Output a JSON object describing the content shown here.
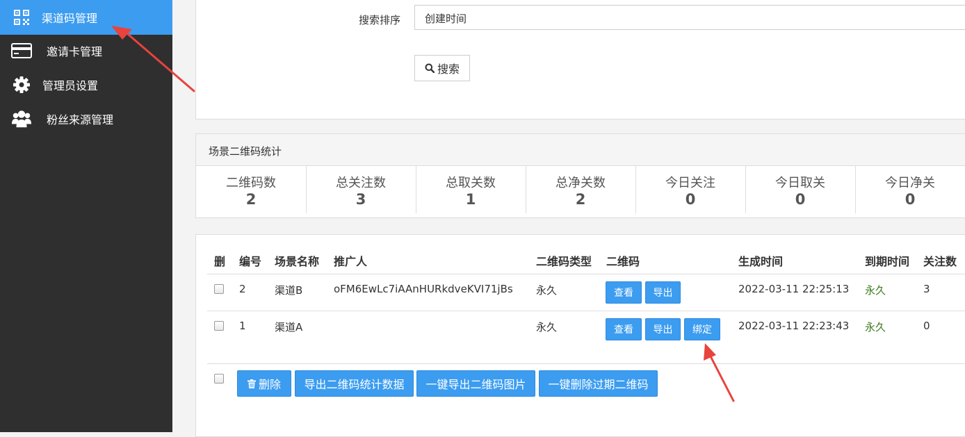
{
  "sidebar": {
    "items": [
      {
        "label": "渠道码管理",
        "icon": "qrcode-icon"
      },
      {
        "label": "邀请卡管理",
        "icon": "credit-card-icon"
      },
      {
        "label": "管理员设置",
        "icon": "gear-icon"
      },
      {
        "label": "粉丝来源管理",
        "icon": "users-icon"
      }
    ],
    "active_color": "#3c9cf0",
    "bg_color": "#2f2f2f"
  },
  "search": {
    "sort_label": "搜索排序",
    "sort_value": "创建时间",
    "search_button": "搜索"
  },
  "stats": {
    "title": "场景二维码统计",
    "items": [
      {
        "label": "二维码数",
        "value": "2"
      },
      {
        "label": "总关注数",
        "value": "3"
      },
      {
        "label": "总取关数",
        "value": "1"
      },
      {
        "label": "总净关数",
        "value": "2"
      },
      {
        "label": "今日关注",
        "value": "0"
      },
      {
        "label": "今日取关",
        "value": "0"
      },
      {
        "label": "今日净关",
        "value": "0"
      }
    ]
  },
  "table": {
    "headers": [
      "删",
      "编号",
      "场景名称",
      "推广人",
      "二维码类型",
      "二维码",
      "生成时间",
      "到期时间",
      "关注数"
    ],
    "rows": [
      {
        "id": "2",
        "name": "渠道B",
        "promoter": "oFM6EwLc7iAAnHURkdveKVI71jBs",
        "type": "永久",
        "created": "2022-03-11 22:25:13",
        "expires": "永久",
        "follows": "3",
        "buttons": [
          "查看",
          "导出"
        ]
      },
      {
        "id": "1",
        "name": "渠道A",
        "promoter": "",
        "type": "永久",
        "created": "2022-03-11 22:23:43",
        "expires": "永久",
        "follows": "0",
        "buttons": [
          "查看",
          "导出",
          "绑定"
        ]
      }
    ]
  },
  "actions": {
    "delete": "删除",
    "export_stats": "导出二维码统计数据",
    "export_images": "一键导出二维码图片",
    "delete_expired": "一键删除过期二维码"
  }
}
